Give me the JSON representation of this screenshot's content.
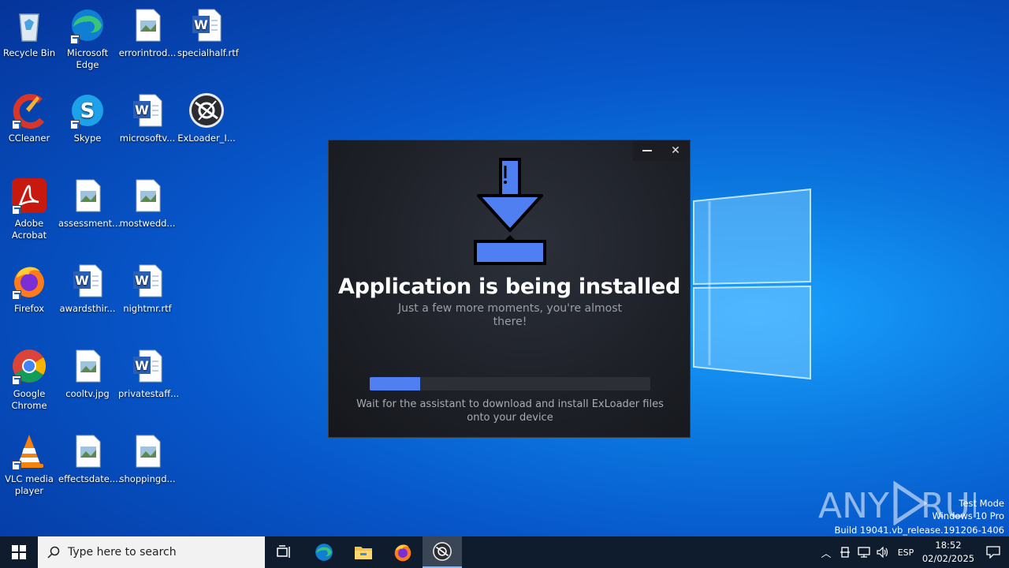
{
  "desktop": {
    "icons": [
      {
        "label": "Recycle Bin"
      },
      {
        "label": "Microsoft Edge"
      },
      {
        "label": "errorintrod..."
      },
      {
        "label": "specialhalf.rtf"
      },
      {
        "label": "CCleaner"
      },
      {
        "label": "Skype"
      },
      {
        "label": "microsoftv..."
      },
      {
        "label": "ExLoader_I..."
      },
      {
        "label": "Adobe Acrobat"
      },
      {
        "label": "assessment..."
      },
      {
        "label": "mostwedd..."
      },
      {
        "label": "Firefox"
      },
      {
        "label": "awardsthir..."
      },
      {
        "label": "nightmr.rtf"
      },
      {
        "label": "Google Chrome"
      },
      {
        "label": "cooltv.jpg"
      },
      {
        "label": "privatestaff..."
      },
      {
        "label": "VLC media player"
      },
      {
        "label": "effectsdate...."
      },
      {
        "label": "shoppingd..."
      }
    ]
  },
  "installer": {
    "title": "Application is being installed",
    "subtitle": "Just a few more moments, you're almost there!",
    "progress": 0.18,
    "wait_text": "Wait for the assistant to download and install ExLoader files onto your device",
    "minimize_icon": "minimize-icon",
    "close_icon": "close-icon",
    "accent": "#4f7ff0"
  },
  "watermark": {
    "logo": "ANY RUN",
    "line1": "Test Mode",
    "line2": "Windows 10 Pro",
    "line3": "Build 19041.vb_release.191206-1406"
  },
  "taskbar": {
    "search_placeholder": "Type here to search",
    "tray_language": "ESP",
    "time": "18:52",
    "date": "02/02/2025"
  }
}
